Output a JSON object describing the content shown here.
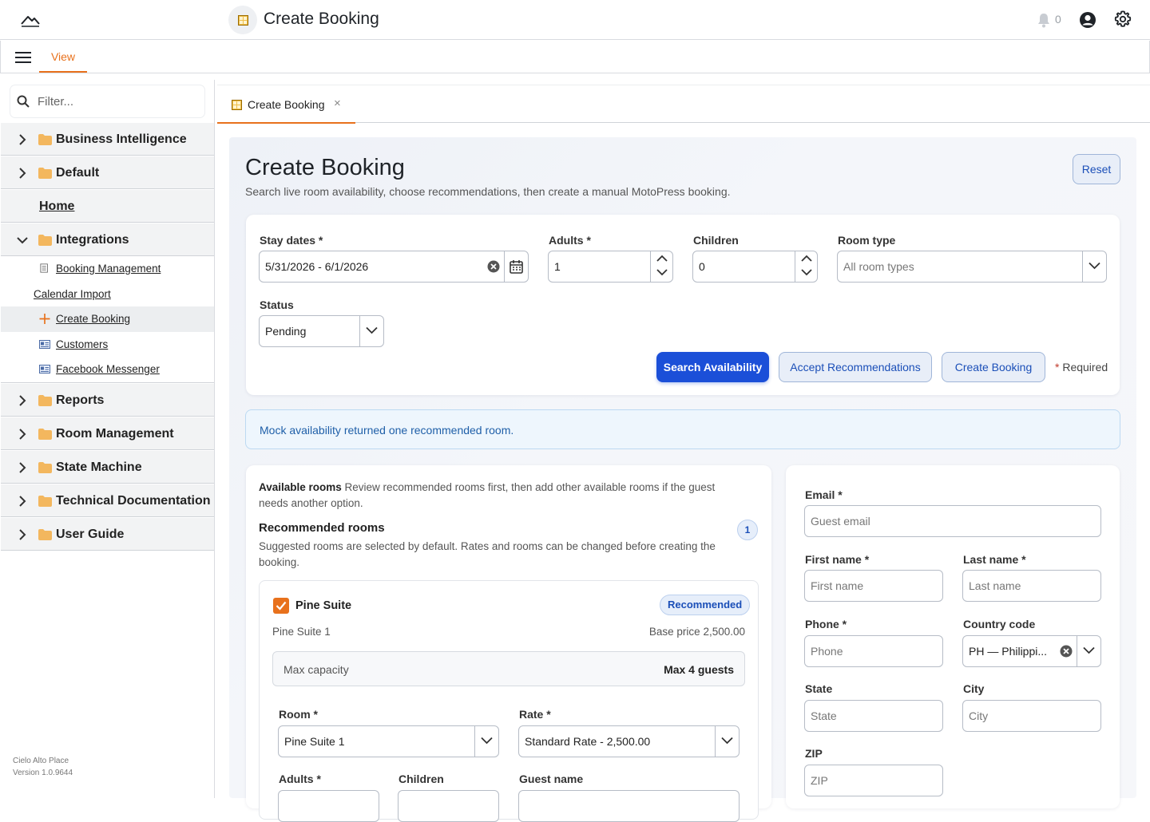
{
  "header": {
    "app_title": "Create Booking",
    "notification_count": "0"
  },
  "menubar": {
    "view_tab": "View"
  },
  "sidebar": {
    "filter_placeholder": "Filter...",
    "nodes": {
      "business_intelligence": "Business Intelligence",
      "default": "Default",
      "home": "Home",
      "integrations": "Integrations",
      "reports": "Reports",
      "room_management": "Room Management",
      "state_machine": "State Machine",
      "technical_documentation": "Technical Documentation",
      "user_guide": "User Guide"
    },
    "integrations_children": {
      "booking_management": "Booking Management",
      "calendar_import": "Calendar Import",
      "create_booking": "Create Booking",
      "customers": "Customers",
      "facebook_messenger": "Facebook Messenger"
    },
    "footer": {
      "company": "Cielo Alto Place",
      "version": "Version 1.0.9644"
    }
  },
  "tabs": {
    "active_tab": "Create Booking",
    "close_glyph": "×"
  },
  "page": {
    "title": "Create Booking",
    "subtitle": "Search live room availability, choose recommendations, then create a manual MotoPress booking.",
    "reset_label": "Reset"
  },
  "search_form": {
    "stay_dates_label": "Stay dates *",
    "stay_dates_value": "5/31/2026 - 6/1/2026",
    "adults_label": "Adults *",
    "adults_value": "1",
    "children_label": "Children",
    "children_value": "0",
    "room_type_label": "Room type",
    "room_type_placeholder": "All room types",
    "status_label": "Status",
    "status_value": "Pending",
    "search_button": "Search Availability",
    "accept_button": "Accept Recommendations",
    "create_button": "Create Booking",
    "required_star": "*",
    "required_text": " Required"
  },
  "alert": {
    "message": "Mock availability returned one recommended room."
  },
  "rooms": {
    "available_heading": "Available rooms",
    "available_desc": " Review recommended rooms first, then add other available rooms if the guest needs another option.",
    "recommended_heading": "Recommended rooms",
    "recommended_desc": "Suggested rooms are selected by default. Rates and rooms can be changed before creating the booking.",
    "recommended_count": "1",
    "room_card": {
      "name": "Pine Suite",
      "badge": "Recommended",
      "unit": "Pine Suite 1",
      "base_price": "Base price 2,500.00",
      "capacity_label": "Max capacity",
      "capacity_value": "Max 4 guests",
      "room_label": "Room *",
      "room_value": "Pine Suite 1",
      "rate_label": "Rate *",
      "rate_value": "Standard Rate - 2,500.00",
      "adults_label": "Adults *",
      "children_label": "Children",
      "guest_name_label": "Guest name"
    }
  },
  "guest_form": {
    "email_label": "Email *",
    "email_placeholder": "Guest email",
    "first_name_label": "First name *",
    "first_name_placeholder": "First name",
    "last_name_label": "Last name *",
    "last_name_placeholder": "Last name",
    "phone_label": "Phone *",
    "phone_placeholder": "Phone",
    "country_label": "Country code",
    "country_value": "PH — Philippi...",
    "state_label": "State",
    "state_placeholder": "State",
    "city_label": "City",
    "city_placeholder": "City",
    "zip_label": "ZIP",
    "zip_placeholder": "ZIP"
  },
  "colors": {
    "accent_orange": "#e8711c",
    "primary_blue": "#1b4fd8",
    "link_blue": "#1b4fb8",
    "folder": "#f3b75e"
  }
}
